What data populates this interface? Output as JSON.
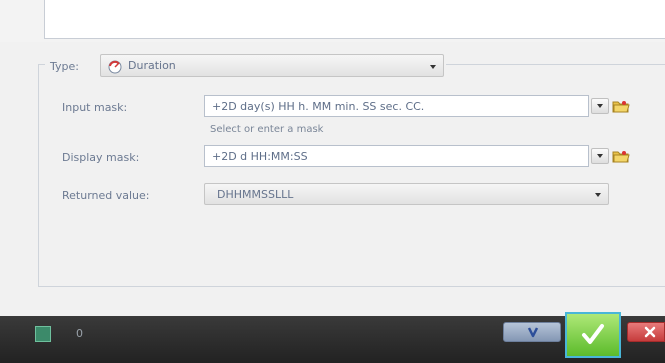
{
  "form": {
    "type_label": "Type:",
    "type_value": "Duration",
    "input_mask_label": "Input mask:",
    "input_mask_value": "+2D day(s) HH h. MM min. SS sec. CC.",
    "input_mask_hint": "Select or enter a mask",
    "display_mask_label": "Display mask:",
    "display_mask_value": "+2D d HH:MM:SS",
    "returned_value_label": "Returned value:",
    "returned_value_value": "DHHMMSSLLL"
  },
  "statusbar": {
    "count": "0"
  },
  "colors": {
    "label_text": "#6c7a92",
    "ok_green": "#6cc93a",
    "cancel_red": "#d34a4a",
    "help_blue": "#8fa2c0",
    "bar_dark": "#2d2d2d"
  },
  "icons": [
    "duration-icon",
    "folder-icon",
    "chevron-down-icon",
    "help-icon",
    "check-icon",
    "close-icon",
    "status-icon"
  ]
}
